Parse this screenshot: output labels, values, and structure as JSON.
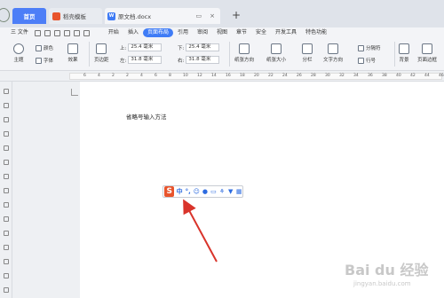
{
  "tabs": {
    "home": "首页",
    "template": "稻壳模板",
    "document": "原文档.docx",
    "new_tab": "+"
  },
  "menu": {
    "file": "三 文件",
    "items": [
      "开始",
      "插入",
      "页面布局",
      "引用",
      "审阅",
      "视图",
      "章节",
      "安全",
      "开发工具",
      "特色功能"
    ],
    "active_index": 2
  },
  "ribbon": {
    "theme": "主题",
    "color": "颜色",
    "font": "字体",
    "effect": "效果",
    "margin": "页边距",
    "top_label": "上:",
    "top_value": "25.4 毫米",
    "bottom_label": "下:",
    "bottom_value": "25.4 毫米",
    "left_label": "左:",
    "left_value": "31.8 毫米",
    "right_label": "右:",
    "right_value": "31.8 毫米",
    "orientation": "纸张方向",
    "size": "纸张大小",
    "columns": "分栏",
    "text_direction": "文字方向",
    "separator": "分隔符",
    "line_number": "行号",
    "background": "背景",
    "page_border": "页面边框"
  },
  "ruler_numbers": [
    "6",
    "4",
    "2",
    "2",
    "4",
    "6",
    "8",
    "10",
    "12",
    "14",
    "16",
    "18",
    "20",
    "22",
    "24",
    "26",
    "28",
    "30",
    "32",
    "34",
    "36",
    "38",
    "40",
    "42",
    "44",
    "46"
  ],
  "document": {
    "text": "省略号输入方法"
  },
  "ime": {
    "logo": "S",
    "mode": "中"
  },
  "watermark": {
    "main": "Bai du 经验",
    "sub": "jingyan.baidu.com"
  },
  "colors": {
    "accent": "#3f7cf6",
    "arrow": "#d9342b",
    "ime_logo": "#e8542c"
  }
}
